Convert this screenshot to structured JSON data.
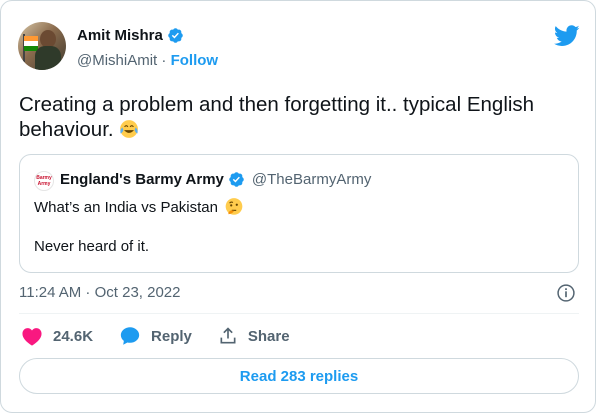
{
  "author": {
    "name": "Amit Mishra",
    "handle": "@MishiAmit",
    "separator": "·",
    "follow_label": "Follow"
  },
  "tweet": {
    "text": "Creating a problem and then forgetting it.. typical English behaviour.",
    "emoji": "face-with-tears-of-joy"
  },
  "quote": {
    "logo_text": "Barmy Army",
    "name": "England's Barmy Army",
    "handle": "@TheBarmyArmy",
    "line1": "What’s an India vs Pakistan",
    "line1_emoji": "thinking-face",
    "line2": "Never heard of it."
  },
  "timestamp": "11:24 AM · Oct 23, 2022",
  "actions": {
    "likes": "24.6K",
    "reply_label": "Reply",
    "share_label": "Share"
  },
  "read_replies_label": "Read 283 replies",
  "colors": {
    "accent": "#1d9bf0",
    "heart": "#f91880",
    "text": "#0f1419",
    "muted": "#536471"
  }
}
